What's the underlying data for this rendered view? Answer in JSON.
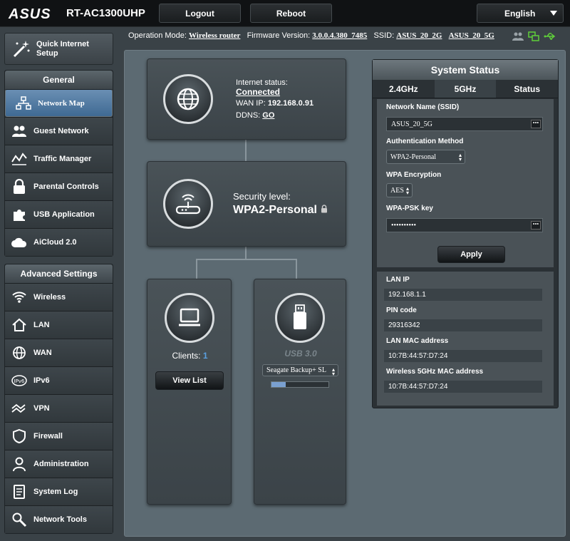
{
  "header": {
    "logo": "ASUS",
    "model": "RT-AC1300UHP",
    "logout_label": "Logout",
    "reboot_label": "Reboot",
    "language": "English"
  },
  "sidebar": {
    "quick_setup": "Quick Internet Setup",
    "general_title": "General",
    "general_items": [
      {
        "label": "Network Map",
        "icon": "network-map-icon"
      },
      {
        "label": "Guest Network",
        "icon": "guest-network-icon"
      },
      {
        "label": "Traffic Manager",
        "icon": "traffic-manager-icon"
      },
      {
        "label": "Parental Controls",
        "icon": "lock-icon"
      },
      {
        "label": "USB Application",
        "icon": "puzzle-icon"
      },
      {
        "label": "AiCloud 2.0",
        "icon": "cloud-icon"
      }
    ],
    "advanced_title": "Advanced Settings",
    "advanced_items": [
      {
        "label": "Wireless",
        "icon": "wireless-icon"
      },
      {
        "label": "LAN",
        "icon": "home-icon"
      },
      {
        "label": "WAN",
        "icon": "globe-icon"
      },
      {
        "label": "IPv6",
        "icon": "ipv6-icon"
      },
      {
        "label": "VPN",
        "icon": "vpn-icon"
      },
      {
        "label": "Firewall",
        "icon": "shield-icon"
      },
      {
        "label": "Administration",
        "icon": "admin-icon"
      },
      {
        "label": "System Log",
        "icon": "log-icon"
      },
      {
        "label": "Network Tools",
        "icon": "tools-icon"
      }
    ]
  },
  "opbar": {
    "mode_label": "Operation Mode:",
    "mode_value": "Wireless router",
    "fw_label": "Firmware Version:",
    "fw_value": "3.0.0.4.380_7485",
    "ssid_label": "SSID:",
    "ssid_2g": "ASUS_20_2G",
    "ssid_5g": "ASUS_20_5G"
  },
  "map": {
    "internet_status_label": "Internet status:",
    "internet_status": "Connected",
    "wan_ip_label": "WAN IP:",
    "wan_ip": "192.168.0.91",
    "ddns_label": "DDNS:",
    "ddns_value": "GO",
    "security_label": "Security level:",
    "security_value": "WPA2-Personal",
    "clients_label": "Clients:",
    "clients_count": "1",
    "view_list": "View List",
    "usb_label": "USB 3.0",
    "usb_device": "Seagate Backup+ SL",
    "usb_usage": 0.25
  },
  "status": {
    "title": "System Status",
    "tabs": [
      "2.4GHz",
      "5GHz",
      "Status"
    ],
    "ssid_label": "Network Name (SSID)",
    "ssid_value": "ASUS_20_5G",
    "auth_label": "Authentication Method",
    "auth_value": "WPA2-Personal",
    "enc_label": "WPA Encryption",
    "enc_value": "AES",
    "psk_label": "WPA-PSK key",
    "psk_value": "••••••••••",
    "apply_label": "Apply",
    "lan_ip_label": "LAN IP",
    "lan_ip": "192.168.1.1",
    "pin_label": "PIN code",
    "pin": "29316342",
    "lan_mac_label": "LAN MAC address",
    "lan_mac": "10:7B:44:57:D7:24",
    "wl_mac_label": "Wireless 5GHz MAC address",
    "wl_mac": "10:7B:44:57:D7:24"
  }
}
